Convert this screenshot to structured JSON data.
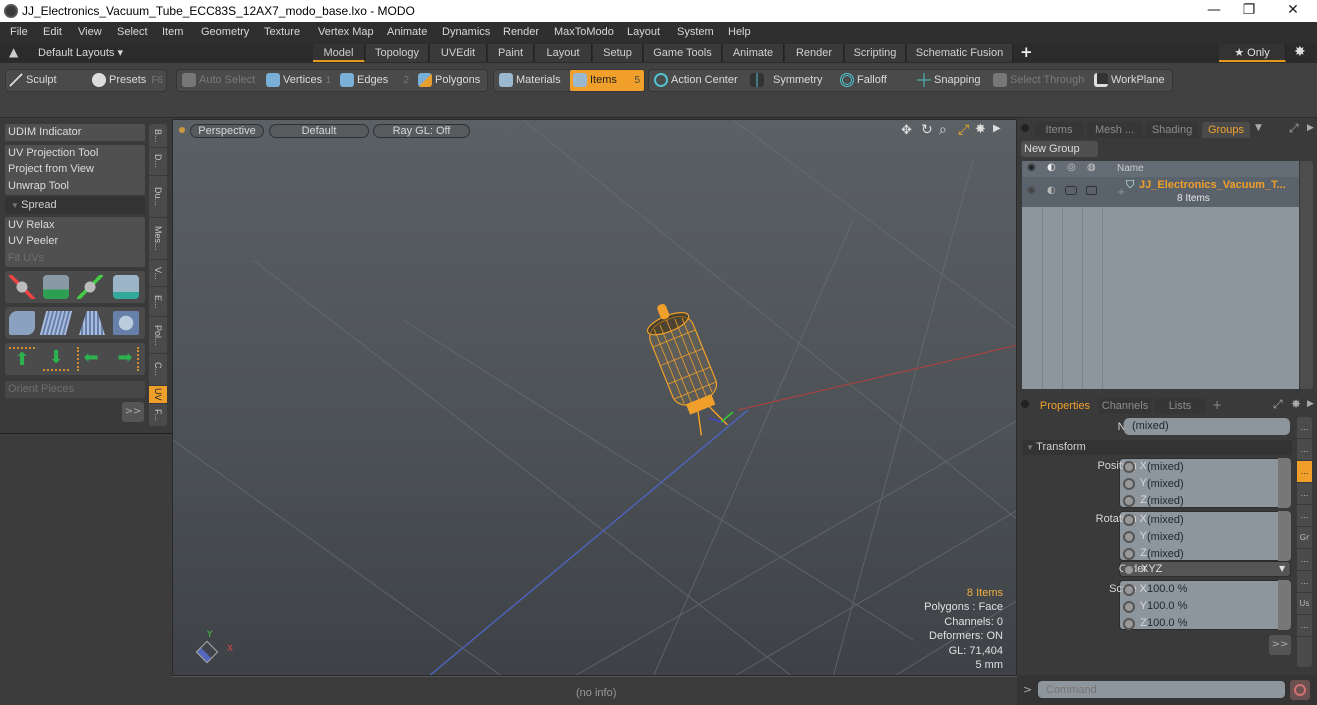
{
  "window": {
    "title": "JJ_Electronics_Vacuum_Tube_ECC83S_12AX7_modo_base.lxo - MODO",
    "controls": {
      "minimize": "—",
      "restore": "❐",
      "close": "✕"
    }
  },
  "menu": [
    "File",
    "Edit",
    "View",
    "Select",
    "Item",
    "Geometry",
    "Texture",
    "Vertex Map",
    "Animate",
    "Dynamics",
    "Render",
    "MaxToModo",
    "Layout",
    "System",
    "Help"
  ],
  "layout_bar": {
    "layouts_label": "Default Layouts ▾",
    "tabs": [
      "Model",
      "Topology",
      "UVEdit",
      "Paint",
      "Layout",
      "Setup",
      "Game Tools",
      "Animate",
      "Render",
      "Scripting",
      "Schematic Fusion"
    ],
    "active_tab": "Model",
    "add_tab": "+",
    "only_label": "★ Only",
    "accent_color": "#e39a1e"
  },
  "toolbar": {
    "sculpt": "Sculpt",
    "presets": "Presets",
    "presets_key": "F6",
    "auto_select": "Auto Select",
    "vertices": "Vertices",
    "vertices_key": "1",
    "edges": "Edges",
    "edges_key": "2",
    "polygons": "Polygons",
    "materials": "Materials",
    "items": "Items",
    "items_key": "5",
    "action_center": "Action Center",
    "symmetry": "Symmetry",
    "falloff": "Falloff",
    "snapping": "Snapping",
    "select_through": "Select Through",
    "workplane": "WorkPlane"
  },
  "left_panel": {
    "udim": "UDIM Indicator",
    "uv_projection": "UV Projection Tool",
    "project_from_view": "Project from View",
    "unwrap": "Unwrap Tool",
    "spread": "Spread",
    "uv_relax": "UV Relax",
    "uv_peeler": "UV Peeler",
    "fit_uvs": "Fit UVs",
    "orient_pieces": "Orient Pieces",
    "more": ">>",
    "vertical_tabs": [
      "B...",
      "D...",
      "Du...",
      "Mes...",
      "V...",
      "E...",
      "Pol...",
      "C...",
      "UV",
      "F..."
    ],
    "active_vertical_tab": "UV"
  },
  "viewport": {
    "view_mode": "Perspective",
    "shading": "Default",
    "raygl": "Ray GL: Off",
    "stats": {
      "items": "8 Items",
      "polygons": "Polygons : Face",
      "channels": "Channels: 0",
      "deformers": "Deformers: ON",
      "gl": "GL: 71,404",
      "scale": "5 mm"
    },
    "axis_labels": {
      "x": "X",
      "y": "Y"
    },
    "status": "(no info)"
  },
  "groups_panel": {
    "tabs": [
      "Items",
      "Mesh ...",
      "Shading",
      "Groups"
    ],
    "active_tab": "Groups",
    "new_group": "New Group",
    "column_name": "Name",
    "group_name": "JJ_Electronics_Vacuum_T...",
    "group_count": "8 Items"
  },
  "properties_panel": {
    "tabs": [
      "Properties",
      "Channels",
      "Lists"
    ],
    "active_tab": "Properties",
    "add_tab": "+",
    "name_label": "Name",
    "name_value": "(mixed)",
    "section": "Transform",
    "rows": [
      {
        "label": "Position X",
        "value": "(mixed)"
      },
      {
        "label": "Y",
        "value": "(mixed)"
      },
      {
        "label": "Z",
        "value": "(mixed)"
      },
      {
        "label": "Rotation X",
        "value": "(mixed)"
      },
      {
        "label": "Y",
        "value": "(mixed)"
      },
      {
        "label": "Z",
        "value": "(mixed)"
      },
      {
        "label": "Order",
        "value": "XYZ"
      },
      {
        "label": "Scale X",
        "value": "100.0 %"
      },
      {
        "label": "Y",
        "value": "100.0 %"
      },
      {
        "label": "Z",
        "value": "100.0 %"
      }
    ],
    "more": ">>",
    "side_tabs": [
      "...",
      "...",
      "...",
      "...",
      "...",
      "Gr",
      "...",
      "...",
      "Us",
      "..."
    ]
  },
  "command_bar": {
    "prompt": ">",
    "placeholder": "Command"
  }
}
